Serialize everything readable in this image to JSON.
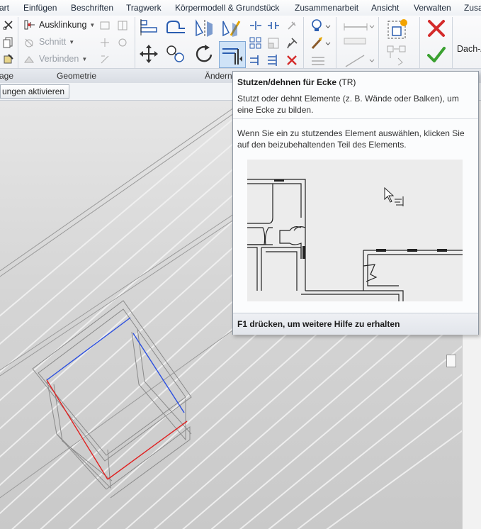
{
  "menubar": {
    "items": [
      "art",
      "Einfügen",
      "Beschriften",
      "Tragwerk",
      "Körpermodell & Grundstück",
      "Zusammenarbeit",
      "Ansicht",
      "Verwalten",
      "Zusa"
    ]
  },
  "ribbon": {
    "geometry": {
      "coping_label": "Ausklinkung",
      "cut_label": "Schnitt",
      "join_label": "Verbinden"
    },
    "panels": {
      "left_partial": "age",
      "geometry": "Geometrie",
      "modify": "Ändern"
    },
    "roof_label": "Dach-/"
  },
  "optionsbar": {
    "button_label": "ungen aktivieren"
  },
  "tooltip": {
    "title": "Stutzen/dehnen für Ecke",
    "shortcut": "(TR)",
    "description": "Stutzt oder dehnt Elemente (z. B. Wände oder Balken), um eine Ecke zu bilden.",
    "detail": "Wenn Sie ein zu stutzendes Element auswählen, klicken Sie auf den beizubehaltenden Teil des Elements.",
    "footer": "F1 drücken, um weitere Hilfe zu erhalten"
  },
  "colors": {
    "selection_blue": "#2b4fe0",
    "selection_red": "#e02020",
    "active_tool": "#cfe3f7",
    "cancel_red": "#d42b2b",
    "finish_green": "#3aa030"
  },
  "icons": {
    "coping": "coping-icon",
    "cut": "cut-icon",
    "join": "join-icon",
    "align": "align-icon",
    "offset": "offset-icon",
    "mirror": "mirror-icon",
    "move": "move-icon",
    "copy": "copy-icon",
    "rotate": "rotate-icon",
    "trim_corner": "trim-extend-corner-icon",
    "split": "split-icon",
    "array": "array-icon",
    "delete": "delete-icon",
    "pin": "pin-icon",
    "visibility": "lightbulb-icon",
    "paint": "brush-icon",
    "measure": "measure-icon",
    "create": "create-similar-icon",
    "cancel": "cancel-icon",
    "finish": "finish-icon"
  }
}
